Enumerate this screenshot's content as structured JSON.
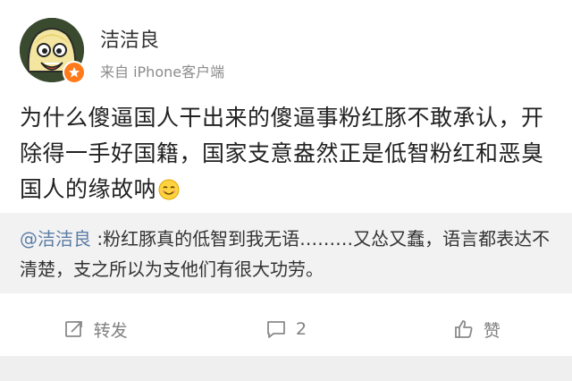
{
  "post": {
    "username": "洁洁良",
    "source": "来自 iPhone客户端",
    "text": "为什么傻逼国人干出来的傻逼事粉红豚不敢承认，开除得一手好国籍，国家支意盎然正是低智粉红和恶臭国人的缘故呐",
    "emoji": "smile-emoji"
  },
  "repost": {
    "mention": "@洁洁良",
    "text": " :粉红豚真的低智到我无语………又怂又蠢，语言都表达不清楚，支之所以为支他们有很大功劳。"
  },
  "toolbar": {
    "repost_label": "转发",
    "comment_count": "2",
    "like_label": "赞"
  },
  "colors": {
    "mention": "#5b7da6",
    "vip_badge": "#ff7a1a",
    "repost_bg": "#f2f2f2"
  }
}
